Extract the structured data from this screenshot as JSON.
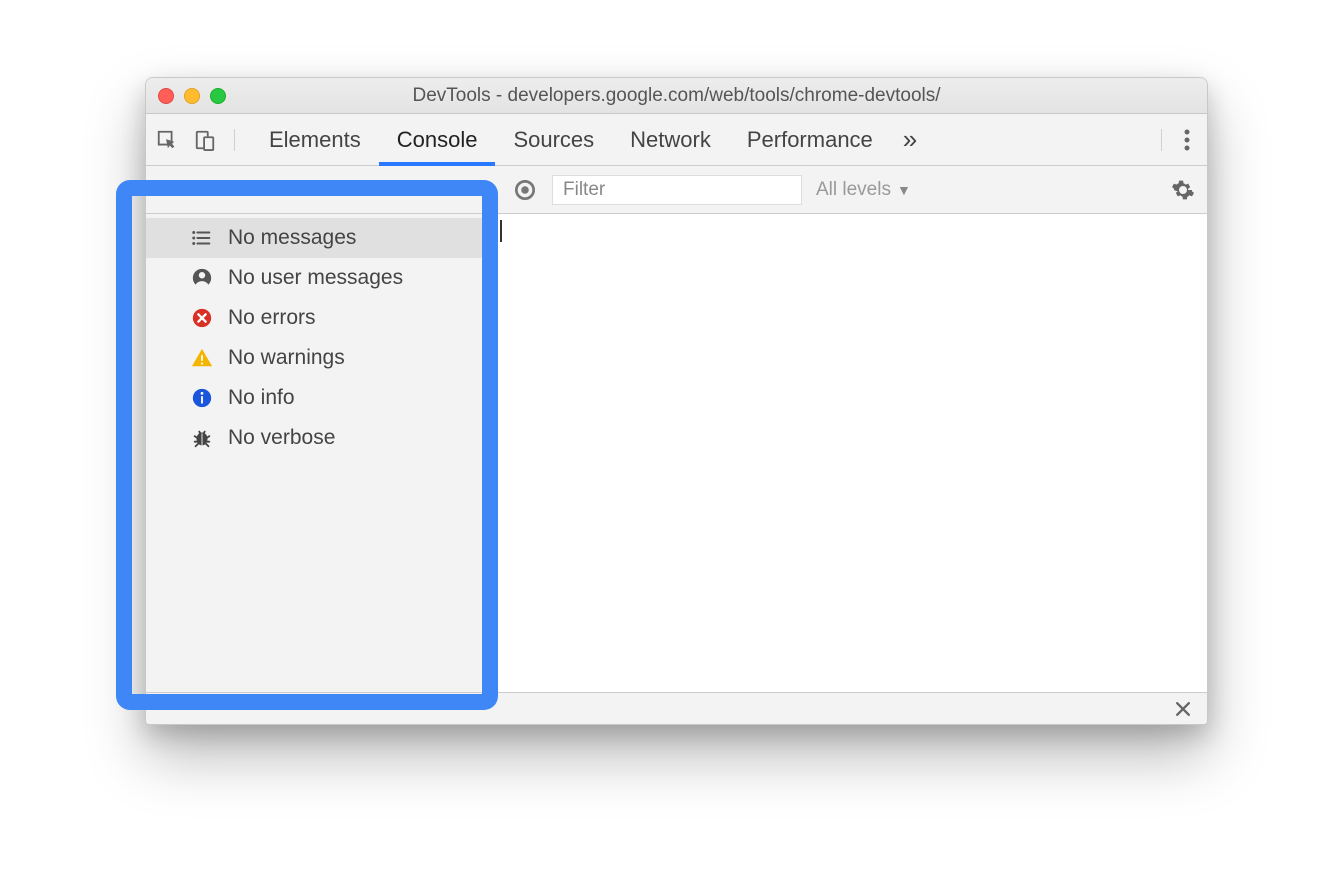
{
  "window": {
    "title": "DevTools - developers.google.com/web/tools/chrome-devtools/"
  },
  "tabs": {
    "items": [
      {
        "label": "Elements"
      },
      {
        "label": "Console"
      },
      {
        "label": "Sources"
      },
      {
        "label": "Network"
      },
      {
        "label": "Performance"
      }
    ],
    "active_index": 1,
    "more_indicator": "»"
  },
  "toolbar": {
    "filter_placeholder": "Filter",
    "filter_value": "",
    "levels_label": "All levels"
  },
  "sidebar": {
    "items": [
      {
        "icon": "list-icon",
        "label": "No messages",
        "selected": true
      },
      {
        "icon": "user-icon",
        "label": "No user messages",
        "selected": false
      },
      {
        "icon": "error-icon",
        "label": "No errors",
        "selected": false
      },
      {
        "icon": "warning-icon",
        "label": "No warnings",
        "selected": false
      },
      {
        "icon": "info-icon",
        "label": "No info",
        "selected": false
      },
      {
        "icon": "bug-icon",
        "label": "No verbose",
        "selected": false
      }
    ]
  }
}
